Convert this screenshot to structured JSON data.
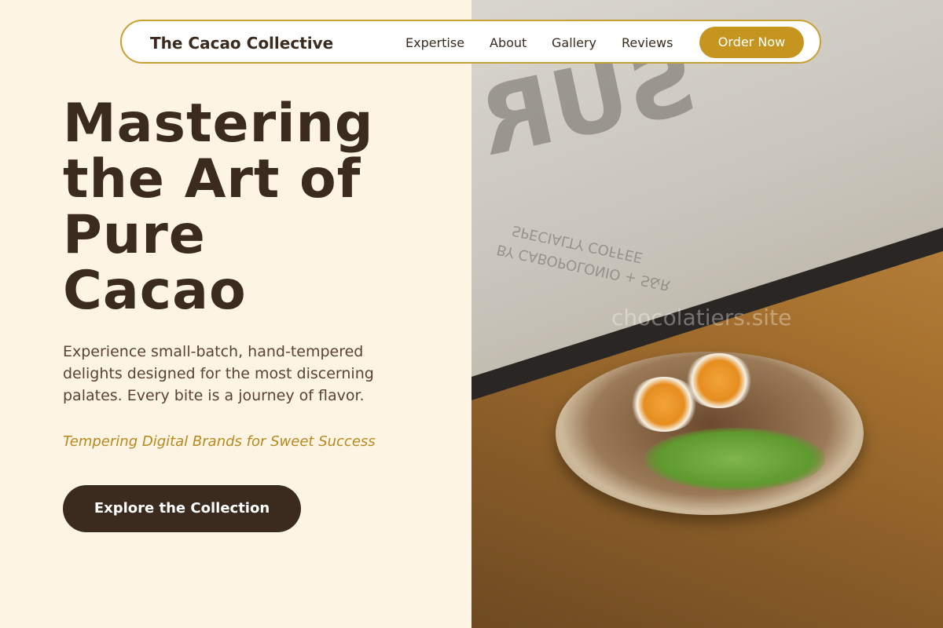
{
  "nav": {
    "brand": "The Cacao Collective",
    "links": [
      "Expertise",
      "About",
      "Gallery",
      "Reviews"
    ],
    "cta": "Order Now"
  },
  "hero": {
    "title_lines": [
      "Mastering",
      "the Art of",
      "Pure",
      "Cacao"
    ],
    "description": "Experience small-batch, hand-tempered delights designed for the most discerning palates. Every bite is a journey of flavor.",
    "tagline": "Tempering Digital Brands for Sweet Success",
    "button": "Explore the Collection"
  },
  "image": {
    "window_text_large": "SUR",
    "window_text_line1": "SPECIALTY COFFEE",
    "window_text_line2": "BY CABOPOLONIO + S&R",
    "watermark": "chocolatiers.site"
  },
  "colors": {
    "background": "#fdf4e3",
    "dark_brown": "#3b2a1e",
    "accent_gold": "#c6951f"
  }
}
